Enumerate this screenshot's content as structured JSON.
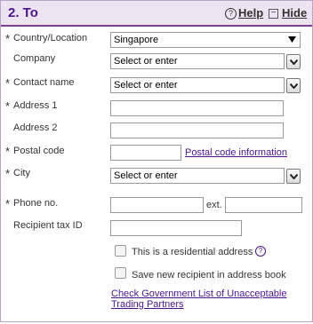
{
  "header": {
    "title": "2. To",
    "help_label": "Help",
    "hide_label": "Hide",
    "help_icon": "?",
    "hide_icon": "−"
  },
  "required_mark": "*",
  "fields": {
    "country": {
      "label": "Country/Location",
      "value": "Singapore"
    },
    "company": {
      "label": "Company",
      "placeholder": "Select or enter"
    },
    "contact": {
      "label": "Contact name",
      "placeholder": "Select or enter"
    },
    "address1": {
      "label": "Address 1",
      "value": ""
    },
    "address2": {
      "label": "Address 2",
      "value": ""
    },
    "postal": {
      "label": "Postal code",
      "value": "",
      "link": "Postal code information"
    },
    "city": {
      "label": "City",
      "placeholder": "Select or enter"
    },
    "phone": {
      "label": "Phone no.",
      "value": "",
      "ext_label": "ext."
    },
    "taxid": {
      "label": "Recipient tax ID",
      "value": ""
    }
  },
  "checkboxes": {
    "residential": {
      "label": "This is a residential address",
      "checked": false,
      "help_icon": "?"
    },
    "save_recipient": {
      "label": "Save new recipient in address book",
      "checked": false
    }
  },
  "gov_link": "Check Government List of Unacceptable Trading Partners",
  "colors": {
    "accent": "#4d148c",
    "header_bg": "#ece4f0"
  }
}
